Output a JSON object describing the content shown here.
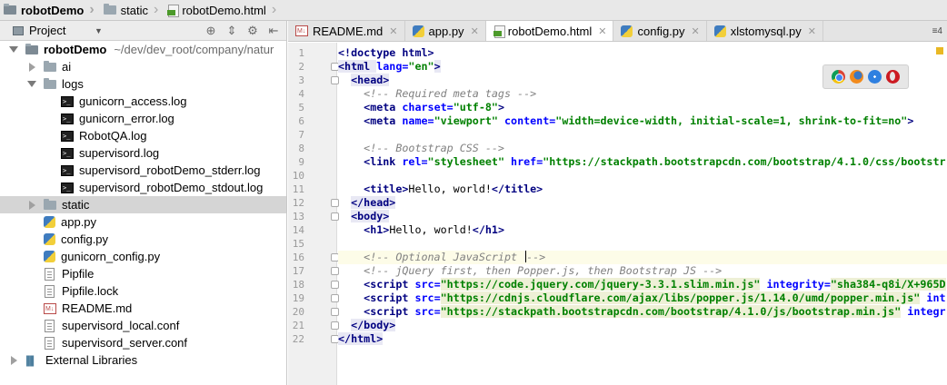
{
  "breadcrumb": [
    "robotDemo",
    "static",
    "robotDemo.html"
  ],
  "project_panel": {
    "title": "Project",
    "root": {
      "name": "robotDemo",
      "path": "~/dev/dev_root/company/natur"
    },
    "tree": [
      {
        "label": "ai",
        "type": "folder",
        "state": "collapsed"
      },
      {
        "label": "logs",
        "type": "folder",
        "state": "expanded"
      },
      {
        "label": "gunicorn_access.log",
        "type": "log"
      },
      {
        "label": "gunicorn_error.log",
        "type": "log"
      },
      {
        "label": "RobotQA.log",
        "type": "log"
      },
      {
        "label": "supervisord.log",
        "type": "log"
      },
      {
        "label": "supervisord_robotDemo_stderr.log",
        "type": "log"
      },
      {
        "label": "supervisord_robotDemo_stdout.log",
        "type": "log"
      },
      {
        "label": "static",
        "type": "folder",
        "state": "collapsed",
        "selected": true
      },
      {
        "label": "app.py",
        "type": "py"
      },
      {
        "label": "config.py",
        "type": "py"
      },
      {
        "label": "gunicorn_config.py",
        "type": "py"
      },
      {
        "label": "Pipfile",
        "type": "file"
      },
      {
        "label": "Pipfile.lock",
        "type": "file"
      },
      {
        "label": "README.md",
        "type": "md"
      },
      {
        "label": "supervisord_local.conf",
        "type": "file"
      },
      {
        "label": "supervisord_server.conf",
        "type": "file"
      }
    ],
    "external_libraries": "External Libraries"
  },
  "tabs": [
    {
      "label": "README.md",
      "icon": "markdown-icon"
    },
    {
      "label": "app.py",
      "icon": "python-icon"
    },
    {
      "label": "robotDemo.html",
      "icon": "html-icon",
      "active": true
    },
    {
      "label": "config.py",
      "icon": "python-icon"
    },
    {
      "label": "xlstomysql.py",
      "icon": "python-icon"
    }
  ],
  "tab_overflow": "≡4",
  "editor": {
    "current_line": 16,
    "lines": [
      [
        [
          "tg",
          "<!doctype "
        ],
        [
          "tg",
          "html"
        ],
        [
          "tg",
          ">"
        ]
      ],
      [
        [
          "tg",
          "<html "
        ],
        [
          "at",
          "lang="
        ],
        [
          "st",
          "\"en\""
        ],
        [
          "tg",
          ">"
        ]
      ],
      [
        [
          "tx",
          "  "
        ],
        [
          "tg",
          "<head>"
        ]
      ],
      [
        [
          "tx",
          "    "
        ],
        [
          "cm",
          "<!-- Required meta tags -->"
        ]
      ],
      [
        [
          "tx",
          "    "
        ],
        [
          "tg",
          "<meta "
        ],
        [
          "at",
          "charset="
        ],
        [
          "st",
          "\"utf-8\""
        ],
        [
          "tg",
          ">"
        ]
      ],
      [
        [
          "tx",
          "    "
        ],
        [
          "tg",
          "<meta "
        ],
        [
          "at",
          "name="
        ],
        [
          "st",
          "\"viewport\""
        ],
        [
          "tx",
          " "
        ],
        [
          "at",
          "content="
        ],
        [
          "st",
          "\"width=device-width, initial-scale=1, shrink-to-fit=no\""
        ],
        [
          "tg",
          ">"
        ]
      ],
      [],
      [
        [
          "tx",
          "    "
        ],
        [
          "cm",
          "<!-- Bootstrap CSS -->"
        ]
      ],
      [
        [
          "tx",
          "    "
        ],
        [
          "tg",
          "<link "
        ],
        [
          "at",
          "rel="
        ],
        [
          "st",
          "\"stylesheet\""
        ],
        [
          "tx",
          " "
        ],
        [
          "at",
          "href="
        ],
        [
          "st",
          "\"https://stackpath.bootstrapcdn.com/bootstrap/4.1.0/css/bootstr"
        ]
      ],
      [],
      [
        [
          "tx",
          "    "
        ],
        [
          "tg",
          "<title>"
        ],
        [
          "tx",
          "Hello, world!"
        ],
        [
          "tg",
          "</title>"
        ]
      ],
      [
        [
          "tx",
          "  "
        ],
        [
          "tg",
          "</head>"
        ]
      ],
      [
        [
          "tx",
          "  "
        ],
        [
          "tg",
          "<body>"
        ]
      ],
      [
        [
          "tx",
          "    "
        ],
        [
          "tg",
          "<h1>"
        ],
        [
          "tx",
          "Hello, world!"
        ],
        [
          "tg",
          "</h1>"
        ]
      ],
      [],
      [
        [
          "tx",
          "    "
        ],
        [
          "cm",
          "<!-- Optional JavaScript "
        ],
        [
          "caret",
          ""
        ],
        [
          "cm",
          "-->"
        ]
      ],
      [
        [
          "tx",
          "    "
        ],
        [
          "cm",
          "<!-- jQuery first, then Popper.js, then Bootstrap JS -->"
        ]
      ],
      [
        [
          "tx",
          "    "
        ],
        [
          "tg",
          "<script "
        ],
        [
          "at",
          "src="
        ],
        [
          "st",
          "\"https://code.jquery.com/jquery-3.3.1.slim.min.js\""
        ],
        [
          "tx",
          " "
        ],
        [
          "at",
          "integrity="
        ],
        [
          "st",
          "\"sha384-q8i/X+965D"
        ]
      ],
      [
        [
          "tx",
          "    "
        ],
        [
          "tg",
          "<script "
        ],
        [
          "at",
          "src="
        ],
        [
          "st",
          "\"https://cdnjs.cloudflare.com/ajax/libs/popper.js/1.14.0/umd/popper.min.js\""
        ],
        [
          "tx",
          " "
        ],
        [
          "at",
          "int"
        ]
      ],
      [
        [
          "tx",
          "    "
        ],
        [
          "tg",
          "<script "
        ],
        [
          "at",
          "src="
        ],
        [
          "st",
          "\"https://stackpath.bootstrapcdn.com/bootstrap/4.1.0/js/bootstrap.min.js\""
        ],
        [
          "tx",
          " "
        ],
        [
          "at",
          "integr"
        ]
      ],
      [
        [
          "tx",
          "  "
        ],
        [
          "tg",
          "</body>"
        ]
      ],
      [
        [
          "tg",
          "</html>"
        ]
      ]
    ]
  },
  "browser_icons": [
    "chrome-icon",
    "firefox-icon",
    "safari-icon",
    "opera-icon"
  ]
}
